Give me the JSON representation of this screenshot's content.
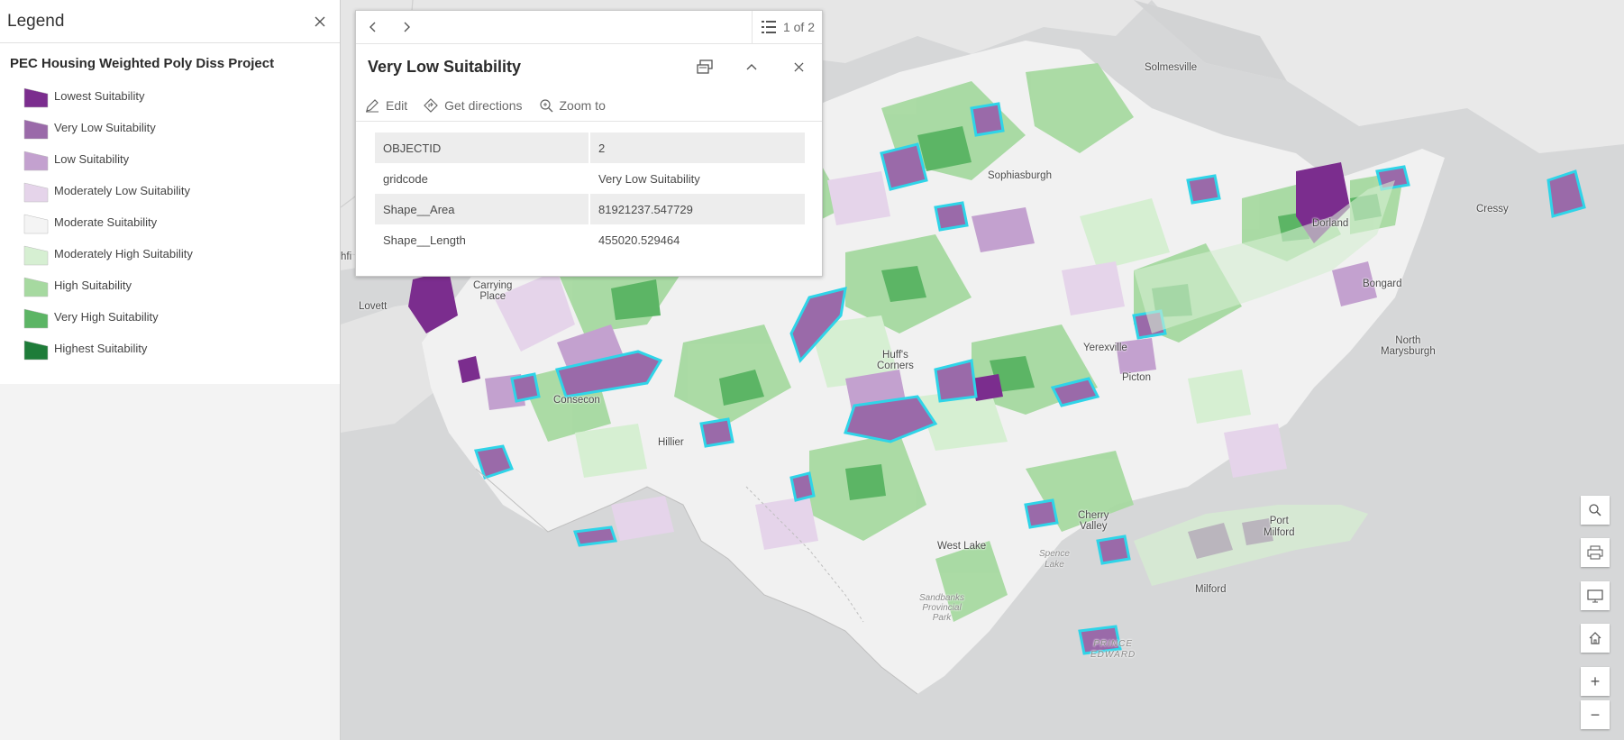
{
  "legend": {
    "title": "Legend",
    "layer_title": "PEC Housing Weighted Poly Diss Project",
    "items": [
      {
        "label": "Lowest Suitability",
        "color": "#7b2d8e"
      },
      {
        "label": "Very Low Suitability",
        "color": "#9a6aa9"
      },
      {
        "label": "Low Suitability",
        "color": "#c3a1cf"
      },
      {
        "label": "Moderately Low Suitability",
        "color": "#e5d4ea"
      },
      {
        "label": "Moderate Suitability",
        "color": "#f4f4f4"
      },
      {
        "label": "Moderately High Suitability",
        "color": "#d6efd2"
      },
      {
        "label": "High Suitability",
        "color": "#a6d9a0"
      },
      {
        "label": "Very High Suitability",
        "color": "#5cb565"
      },
      {
        "label": "Highest Suitability",
        "color": "#1e7c39"
      }
    ]
  },
  "popup": {
    "feature_count": "1 of 2",
    "title": "Very Low Suitability",
    "actions": {
      "edit": "Edit",
      "directions": "Get directions",
      "zoom": "Zoom to"
    },
    "attributes": [
      {
        "field": "OBJECTID",
        "value": "2"
      },
      {
        "field": "gridcode",
        "value": "Very Low Suitability"
      },
      {
        "field": "Shape__Area",
        "value": "81921237.547729"
      },
      {
        "field": "Shape__Length",
        "value": "455020.529464"
      }
    ]
  },
  "map": {
    "places": {
      "solmesville": "Solmesville",
      "sophiasburgh": "Sophiasburgh",
      "dorland": "Dorland",
      "cressy": "Cressy",
      "bongard": "Bongard",
      "north_marysburgh": "North\nMarysburgh",
      "yerexville": "Yerexville",
      "picton": "Picton",
      "huffs_corners": "Huff's\nCorners",
      "carrying_place": "Carrying\nPlace",
      "lovett": "Lovett",
      "consecon": "Consecon",
      "hillier": "Hillier",
      "west_lake": "West Lake",
      "spence_lake": "Spence\nLake",
      "sandbanks": "Sandbanks\nProvincial\nPark",
      "cherry_valley": "Cherry\nValley",
      "port_milford": "Port\nMilford",
      "milford": "Milford",
      "prince_edward": "PRINCE\nEDWARD",
      "shfi": "hfi"
    },
    "water_color": "#d5d6d7",
    "land_color": "#e8e8e8",
    "highlight_color": "#2fd4e8"
  },
  "widgets": {
    "search": "search-icon",
    "print": "print-icon",
    "basemap": "monitor-icon",
    "home": "home-icon",
    "zoom_in": "+",
    "zoom_out": "−"
  }
}
